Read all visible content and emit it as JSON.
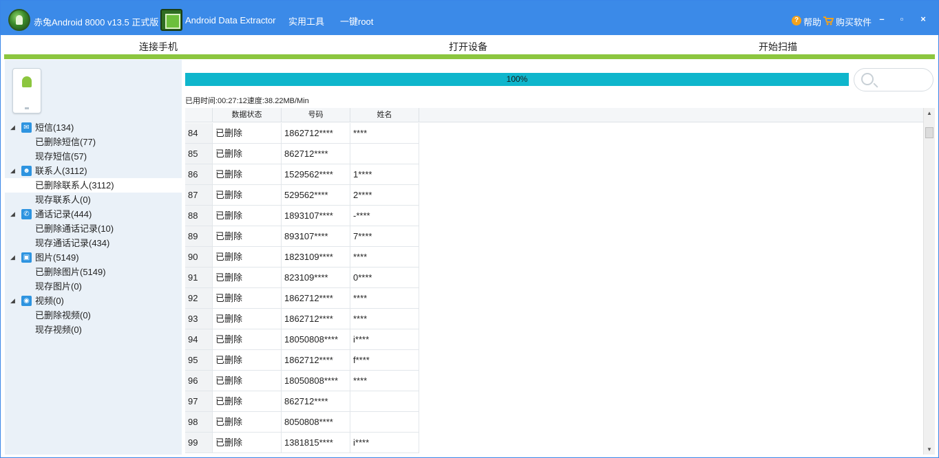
{
  "window": {
    "title": "赤兔Android 8000 v13.5 正式版",
    "extractor_title": "Android Data Extractor",
    "menu_tools": "实用工具",
    "menu_root": "一键root",
    "help_label": "帮助",
    "buy_label": "购买软件",
    "minimize_label": "–",
    "maximize_label": "▫",
    "close_label": "×"
  },
  "toolbar": {
    "connect_label": "连接手机",
    "open_label": "打开设备",
    "scan_label": "开始扫描"
  },
  "progress": {
    "percent": 100,
    "label": "100%"
  },
  "elapsed": "已用时间:00:27:12速度:38.22MB/Min",
  "tree": {
    "sms": {
      "label": "短信(134)",
      "deleted": "已删除短信(77)",
      "existing": "现存短信(57)"
    },
    "contacts": {
      "label": "联系人(3112)",
      "deleted": "已删除联系人(3112)",
      "existing": "现存联系人(0)"
    },
    "calls": {
      "label": "通话记录(444)",
      "deleted": "已删除通话记录(10)",
      "existing": "现存通话记录(434)"
    },
    "photos": {
      "label": "图片(5149)",
      "deleted": "已删除图片(5149)",
      "existing": "现存图片(0)"
    },
    "videos": {
      "label": "视频(0)",
      "deleted": "已删除视频(0)",
      "existing": "现存视频(0)"
    }
  },
  "table": {
    "headers": {
      "status": "数据状态",
      "phone": "号码",
      "name": "姓名"
    },
    "rows": [
      {
        "num": "84",
        "status": "已删除",
        "phone": "1862712****",
        "name": "****"
      },
      {
        "num": "85",
        "status": "已删除",
        "phone": "862712****",
        "name": ""
      },
      {
        "num": "86",
        "status": "已删除",
        "phone": "1529562****",
        "name": "1****"
      },
      {
        "num": "87",
        "status": "已删除",
        "phone": "529562****",
        "name": "2****"
      },
      {
        "num": "88",
        "status": "已删除",
        "phone": "1893107****",
        "name": "-****"
      },
      {
        "num": "89",
        "status": "已删除",
        "phone": "893107****",
        "name": "7****"
      },
      {
        "num": "90",
        "status": "已删除",
        "phone": "1823109****",
        "name": " ****"
      },
      {
        "num": "91",
        "status": "已删除",
        "phone": "823109****",
        "name": "0****"
      },
      {
        "num": "92",
        "status": "已删除",
        "phone": "1862712****",
        "name": " ****"
      },
      {
        "num": "93",
        "status": "已删除",
        "phone": "1862712****",
        "name": "****"
      },
      {
        "num": "94",
        "status": "已删除",
        "phone": "18050808****",
        "name": "i****"
      },
      {
        "num": "95",
        "status": "已删除",
        "phone": "1862712****",
        "name": "f****"
      },
      {
        "num": "96",
        "status": "已删除",
        "phone": "18050808****",
        "name": "****"
      },
      {
        "num": "97",
        "status": "已删除",
        "phone": "862712****",
        "name": ""
      },
      {
        "num": "98",
        "status": "已删除",
        "phone": "8050808****",
        "name": ""
      },
      {
        "num": "99",
        "status": "已删除",
        "phone": "1381815****",
        "name": "i****"
      }
    ]
  }
}
